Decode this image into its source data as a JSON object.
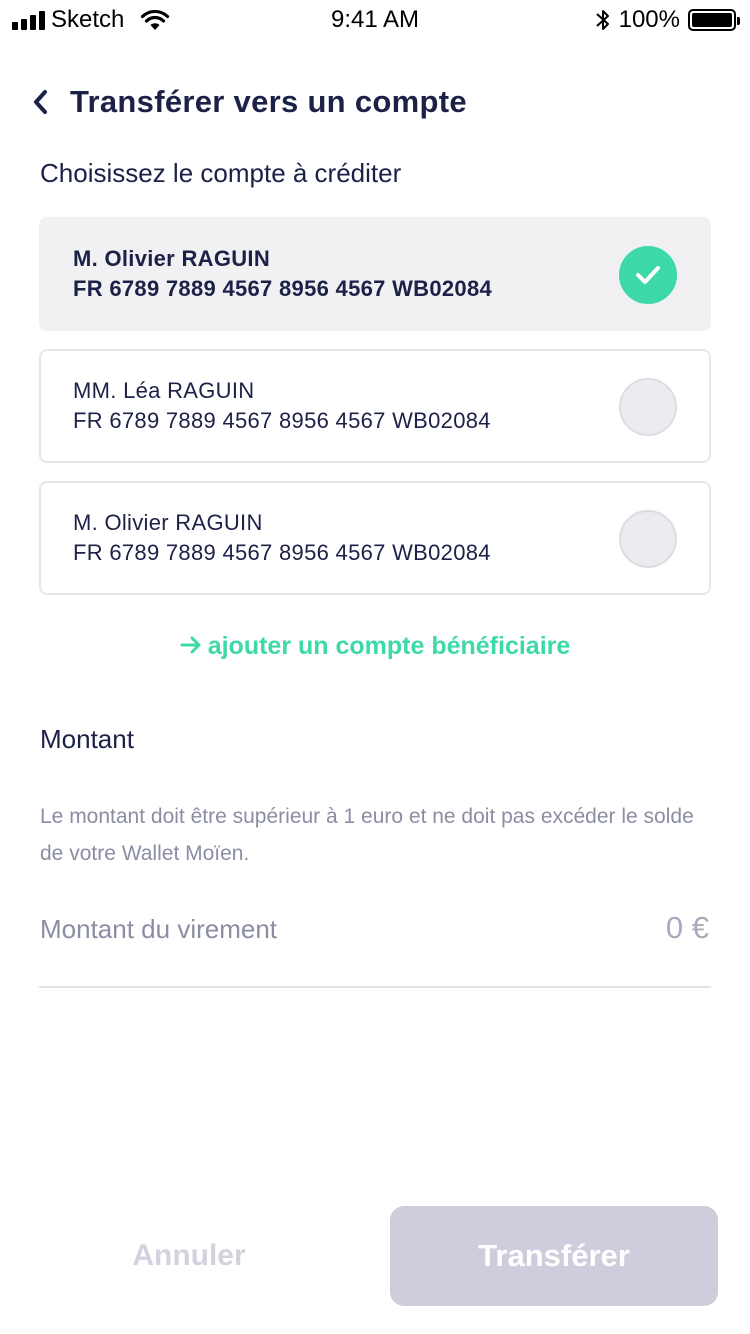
{
  "status_bar": {
    "carrier": "Sketch",
    "time": "9:41 AM",
    "battery": "100%",
    "battery_level": 1.0
  },
  "header": {
    "title": "Transférer vers un compte",
    "back_icon": "chevron-left-icon"
  },
  "accounts_section": {
    "label": "Choisissez le compte à créditer",
    "accounts": [
      {
        "name": "M. Olivier RAGUIN",
        "iban": "FR 6789 7889 4567 8956 4567 WB02084",
        "selected": true
      },
      {
        "name": "MM. Léa RAGUIN",
        "iban": "FR 6789 7889 4567 8956 4567 WB02084",
        "selected": false
      },
      {
        "name": "M. Olivier RAGUIN",
        "iban": "FR 6789 7889 4567 8956 4567 WB02084",
        "selected": false
      }
    ],
    "add_link": "ajouter un compte bénéficiaire"
  },
  "amount_section": {
    "label": "Montant",
    "hint": "Le montant doit être supérieur à 1 euro et ne doit pas excéder le solde de votre Wallet Moïen.",
    "field_label": "Montant du virement",
    "field_value": "0 €"
  },
  "actions": {
    "cancel": "Annuler",
    "transfer": "Transférer"
  },
  "colors": {
    "primary_text": "#1c2147",
    "accent": "#3dd9a9",
    "muted_text": "#8b8ea3",
    "disabled_button": "#cdcddb"
  }
}
